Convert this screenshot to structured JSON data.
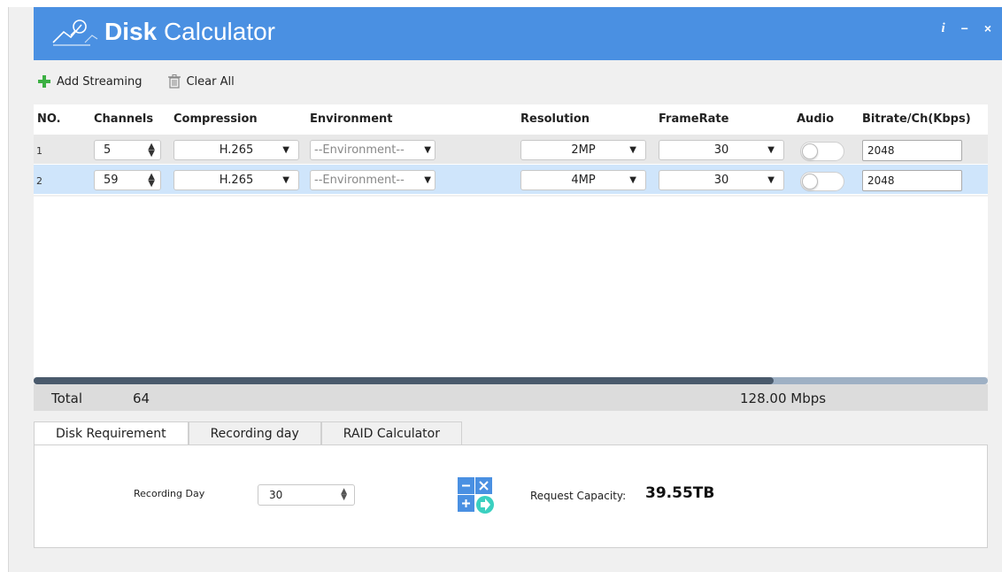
{
  "app": {
    "title_bold": "Disk",
    "title_rest": "Calculator",
    "controls": {
      "info": "i",
      "minimize": "−",
      "close": "×"
    }
  },
  "toolbar": {
    "add_label": "Add Streaming",
    "clear_label": "Clear All"
  },
  "table": {
    "headers": {
      "no": "NO.",
      "channels": "Channels",
      "compression": "Compression",
      "environment": "Environment",
      "resolution": "Resolution",
      "framerate": "FrameRate",
      "audio": "Audio",
      "bitrate": "Bitrate/Ch(Kbps)"
    },
    "rows": [
      {
        "no": "1",
        "channels": "5",
        "compression": "H.265",
        "environment": "--Environment--",
        "resolution": "2MP",
        "framerate": "30",
        "audio": false,
        "bitrate": "2048"
      },
      {
        "no": "2",
        "channels": "59",
        "compression": "H.265",
        "environment": "--Environment--",
        "resolution": "4MP",
        "framerate": "30",
        "audio": false,
        "bitrate": "2048"
      }
    ],
    "selected_row": 2
  },
  "total": {
    "label": "Total",
    "channels": "64",
    "bandwidth": "128.00 Mbps"
  },
  "tabs": [
    {
      "label": "Disk Requirement",
      "active": true
    },
    {
      "label": "Recording day",
      "active": false
    },
    {
      "label": "RAID Calculator",
      "active": false
    }
  ],
  "disk_requirement": {
    "recording_day_label": "Recording Day",
    "recording_day_value": "30",
    "request_label": "Request Capacity:",
    "request_value": "39.55TB"
  },
  "colors": {
    "titlebar": "#4a90e2",
    "selected_row": "#cfe5fb",
    "add_icon": "#3cb043"
  }
}
